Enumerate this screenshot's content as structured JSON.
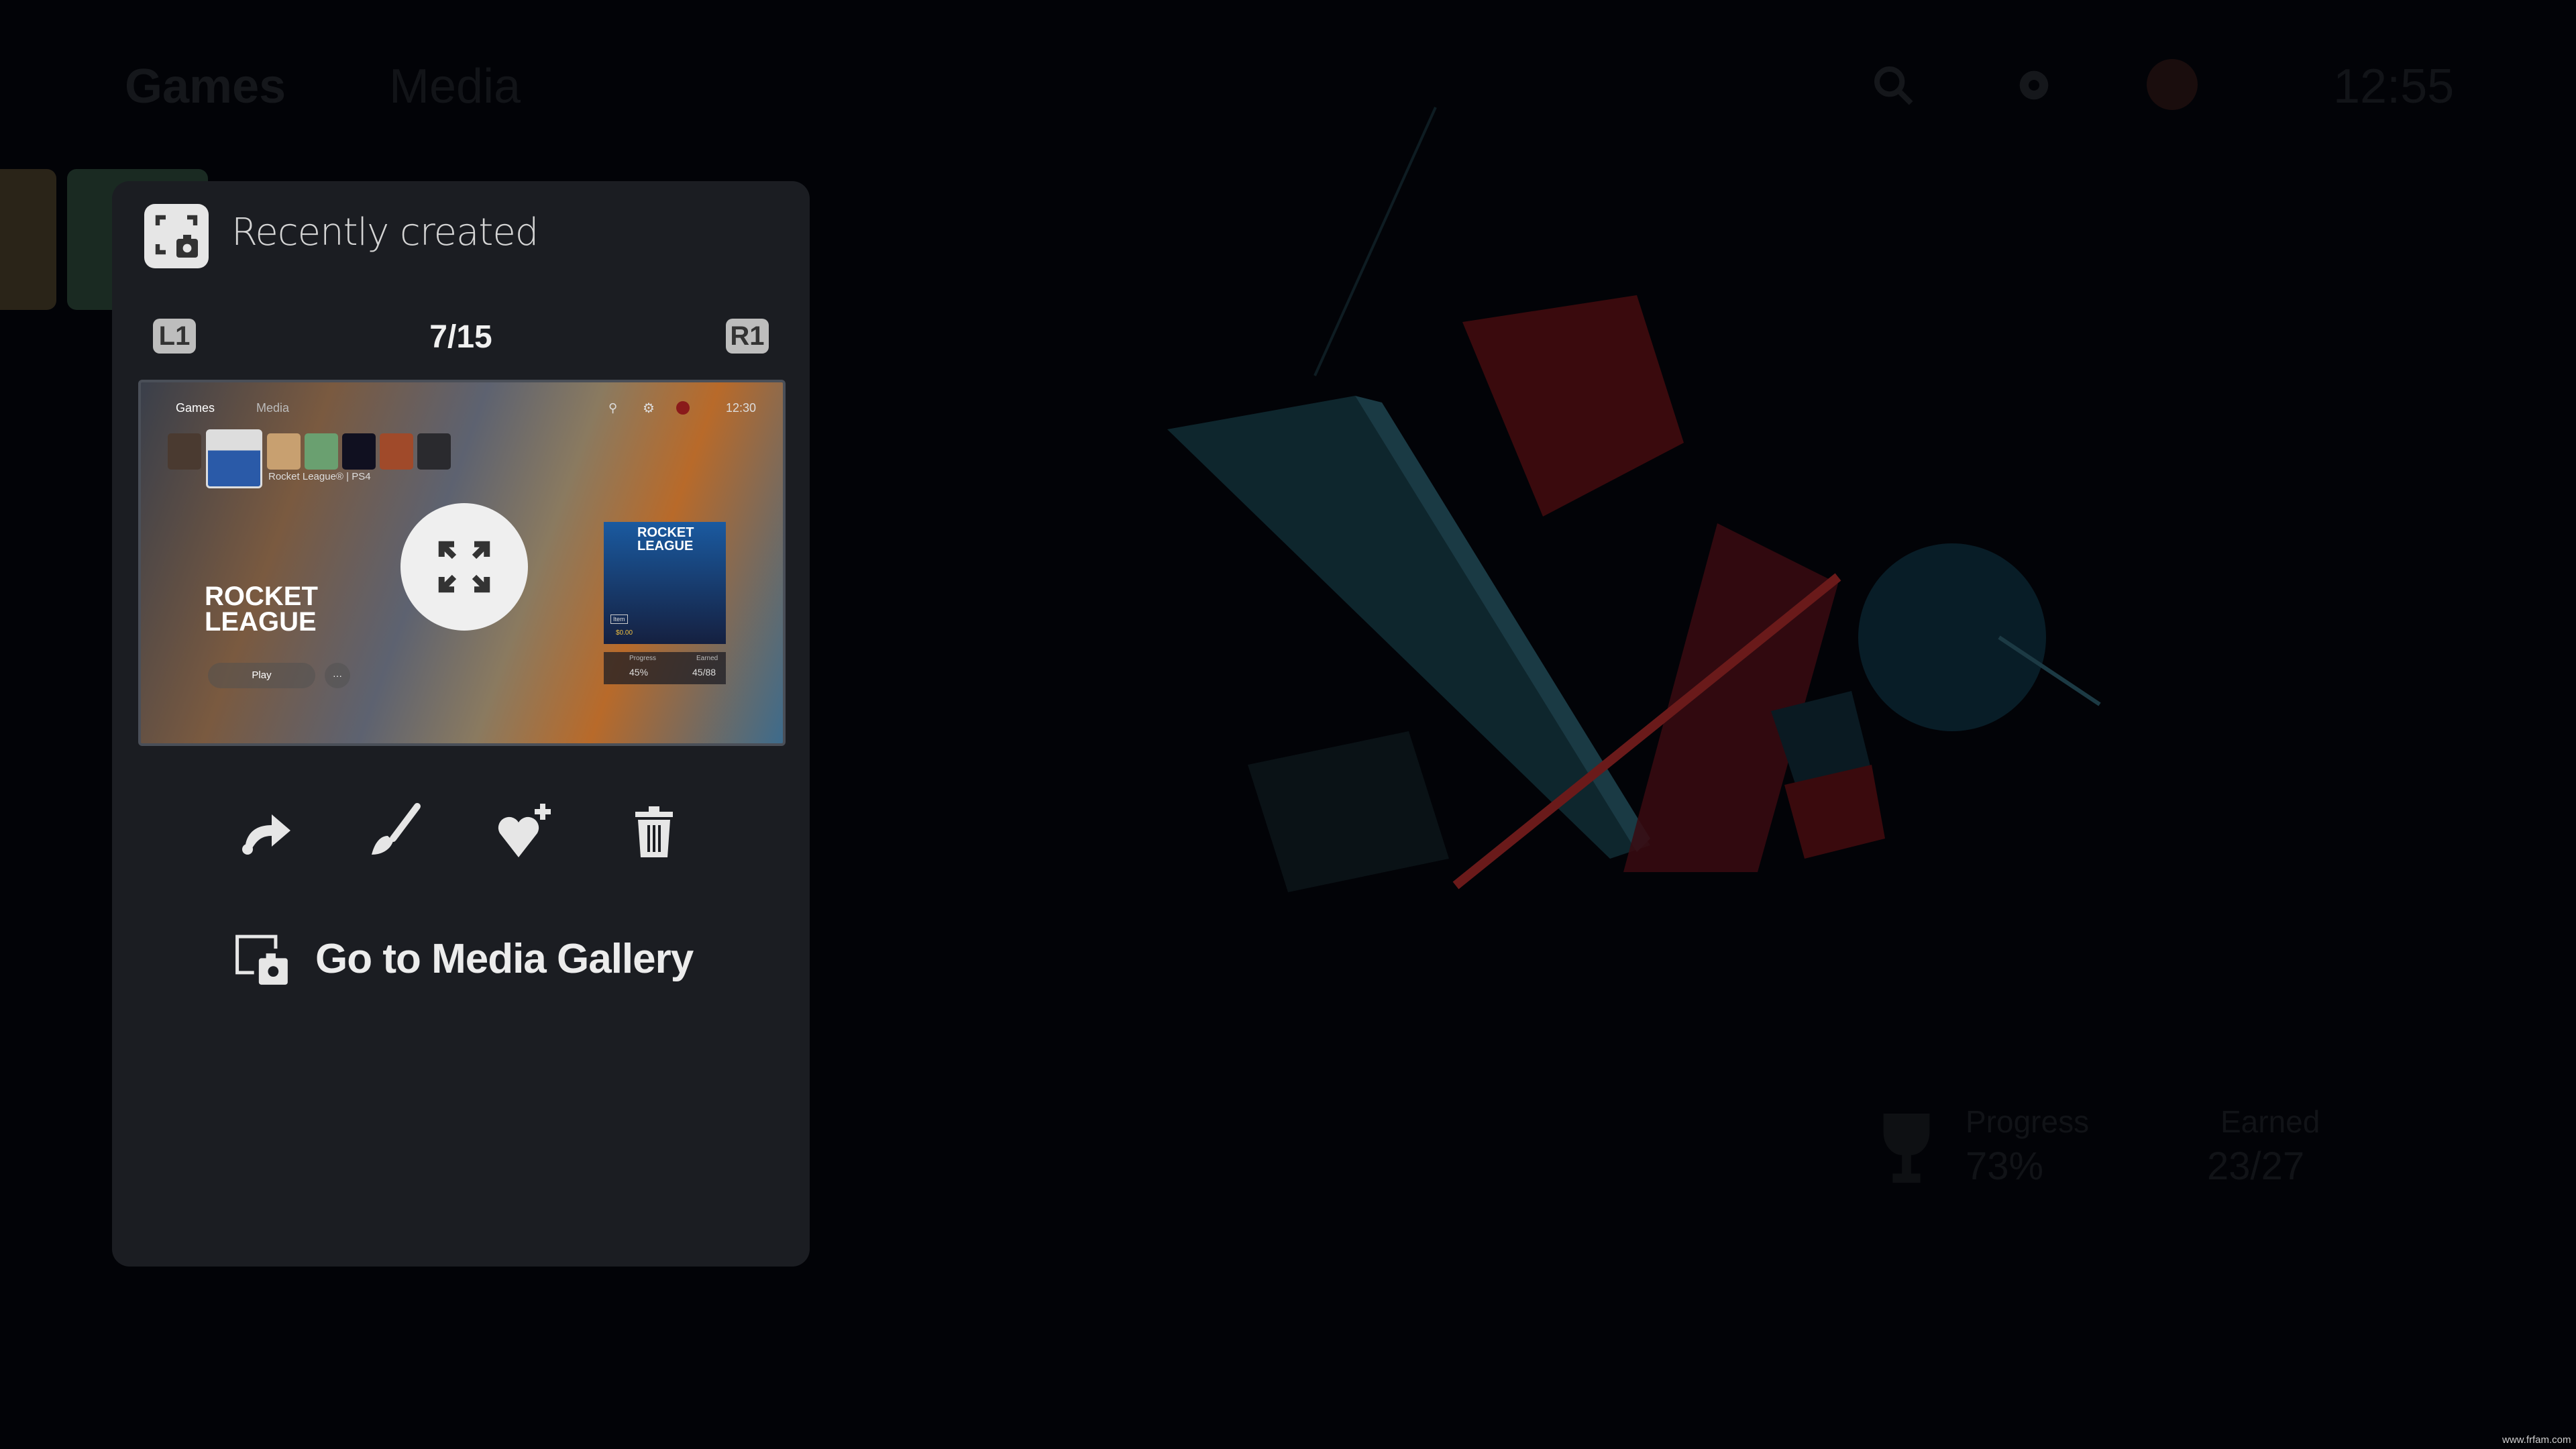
{
  "topbar": {
    "tabs": [
      "Games",
      "Media"
    ],
    "time": "12:55",
    "icons": [
      "search-icon",
      "gear-icon",
      "avatar"
    ]
  },
  "background": {
    "trophy": {
      "progress_label": "Progress",
      "progress_value": "73%",
      "earned_label": "Earned",
      "earned_value": "23/27"
    },
    "watermark": "www.frfam.com"
  },
  "panel": {
    "title": "Recently created",
    "left_button": "L1",
    "right_button": "R1",
    "counter": "7/15",
    "thumbnail": {
      "tabs": [
        "Games",
        "Media"
      ],
      "time": "12:30",
      "game_label": "Rocket League® | PS4",
      "logo": "ROCKET LEAGUE",
      "play": "Play",
      "more": "···",
      "card_title": "ROCKET LEAGUE",
      "item": "Item",
      "price": "$0.00",
      "progress_label": "Progress",
      "progress_value": "45%",
      "earned_label": "Earned",
      "earned_value": "45/88"
    },
    "actions": [
      "share-icon",
      "edit-brush-icon",
      "favorite-add-icon",
      "trash-icon"
    ],
    "gallery_link": "Go to Media Gallery"
  },
  "colors": {
    "panel": "#1b1d22",
    "text": "#e8e8e8",
    "badge": "#bdbdbd"
  }
}
